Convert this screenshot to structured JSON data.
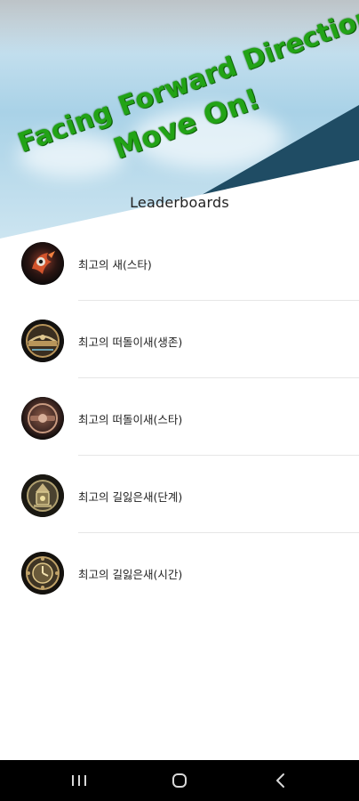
{
  "banner": {
    "line1": "Facing Forward Direction",
    "line2": "Move On!"
  },
  "page": {
    "title": "Leaderboards"
  },
  "leaderboards": [
    {
      "label": "최고의 새(스타)",
      "icon": "bird-emblem-icon"
    },
    {
      "label": "최고의 떠돌이새(생존)",
      "icon": "bridge-emblem-icon"
    },
    {
      "label": "최고의 떠돌이새(스타)",
      "icon": "bronze-emblem-icon"
    },
    {
      "label": "최고의 길잃은새(단계)",
      "icon": "lantern-emblem-icon"
    },
    {
      "label": "최고의 길잃은새(시간)",
      "icon": "clock-emblem-icon"
    }
  ],
  "nav": {
    "recent": "recent-apps-icon",
    "home": "home-icon",
    "back": "back-icon"
  },
  "colors": {
    "banner_text": "#22a316",
    "sky": "#a9d2e7",
    "dark_slab": "#1f4c64",
    "navbar": "#000000"
  }
}
